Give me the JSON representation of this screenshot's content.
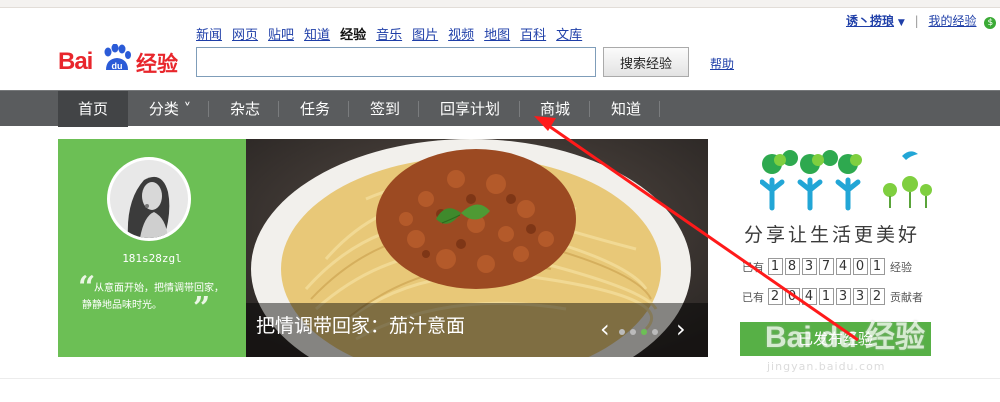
{
  "logo": {
    "bai": "Bai",
    "du": "du",
    "jingyan": "经验"
  },
  "top_nav": [
    {
      "label": "新闻"
    },
    {
      "label": "网页"
    },
    {
      "label": "贴吧"
    },
    {
      "label": "知道"
    },
    {
      "label": "经验",
      "active": true
    },
    {
      "label": "音乐"
    },
    {
      "label": "图片"
    },
    {
      "label": "视频"
    },
    {
      "label": "地图"
    },
    {
      "label": "百科"
    },
    {
      "label": "文库"
    }
  ],
  "search": {
    "value": "",
    "button_label": "搜索经验",
    "help_label": "帮助"
  },
  "user_menu": {
    "username": "诱丶捞琅",
    "my_jingyan": "我的经验",
    "separator": "|"
  },
  "main_nav": [
    {
      "label": "首页",
      "active": true
    },
    {
      "label": "分类 ˅"
    },
    {
      "label": "杂志"
    },
    {
      "label": "任务"
    },
    {
      "label": "签到"
    },
    {
      "label": "回享计划"
    },
    {
      "label": "商城"
    },
    {
      "label": "知道"
    }
  ],
  "profile": {
    "username": "181s28zgl",
    "quote_open": "“",
    "quote_close": "”",
    "motto": "从意面开始，把情调带回家，静静地品味时光。"
  },
  "banner": {
    "caption": "把情调带回家：茄汁意面",
    "prev": "‹",
    "next": "›",
    "dots": 4,
    "active_dot": 2
  },
  "promo": {
    "slogan": "分享让生活更美好",
    "stats": [
      {
        "prefix": "已有",
        "digits": [
          "1",
          "8",
          "3",
          "7",
          "4",
          "0",
          "1"
        ],
        "suffix": "经验"
      },
      {
        "prefix": "已有",
        "digits": [
          "2",
          "0",
          "4",
          "1",
          "3",
          "3",
          "2"
        ],
        "suffix": "贡献者"
      }
    ],
    "share_button": "已发布经验"
  },
  "watermark": {
    "logo": "Bai du 经验",
    "url": "jingyan.baidu.com"
  },
  "colors": {
    "brand_red": "#e8262c",
    "nav_gray": "#5a5c5e",
    "green": "#6cbf55",
    "link_blue": "#1f3fa8",
    "annotation_red": "#ff1a1a"
  }
}
